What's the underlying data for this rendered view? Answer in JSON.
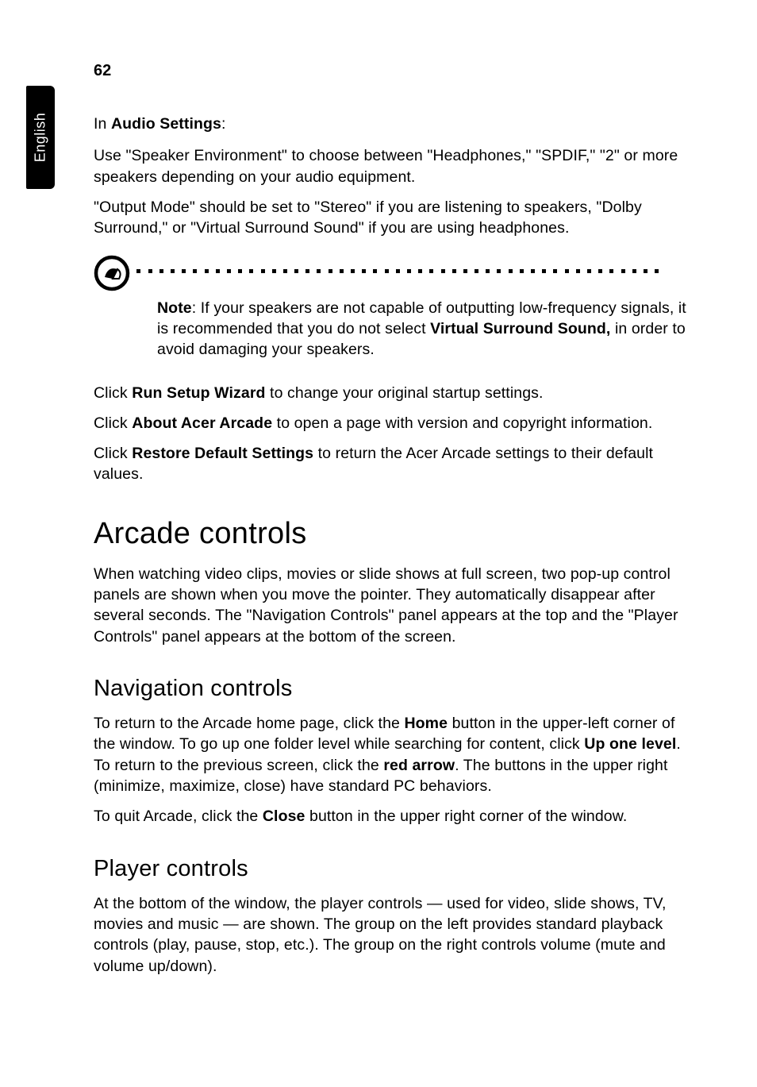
{
  "tab": {
    "label": "English"
  },
  "pageNumber": "62",
  "p1": {
    "pre": "In ",
    "bold": "Audio Settings",
    "post": ":"
  },
  "p2": "Use \"Speaker Environment\" to choose between \"Headphones,\" \"SPDIF,\" \"2\" or more speakers depending on your audio equipment.",
  "p3": "\"Output Mode\" should be set to \"Stereo\" if you are listening to speakers, \"Dolby Surround,\" or \"Virtual Surround Sound\" if you are using headphones.",
  "note": {
    "part1_bold": "Note",
    "part1_rest": ": If your speakers are not capable of outputting low-frequency signals, it is recommended that you do not select ",
    "part2_bold": "Virtual Surround Sound,",
    "part2_rest": " in order to avoid damaging your speakers."
  },
  "p4": {
    "pre": "Click ",
    "bold": "Run Setup Wizard",
    "post": " to change your original startup settings."
  },
  "p5": {
    "pre": "Click ",
    "bold": "About Acer Arcade",
    "post": " to open a page with version and copyright information."
  },
  "p6": {
    "pre": "Click ",
    "bold": "Restore Default Settings",
    "post": " to return the Acer Arcade settings to their default values."
  },
  "h1": "Arcade controls",
  "p7": "When watching video clips, movies or slide shows at full screen, two pop-up control panels are shown when you move the pointer. They automatically disappear after several seconds. The \"Navigation Controls\" panel appears at the top and the \"Player Controls\" panel appears at the bottom of the screen.",
  "h2a": "Navigation controls",
  "p8": {
    "t1": "To return to the Arcade home page, click the ",
    "b1": "Home",
    "t2": " button in the upper-left corner of the window. To go up one folder level while searching for content, click ",
    "b2": "Up one level",
    "t3": ". To return to the previous screen, click the ",
    "b3": "red arrow",
    "t4": ". The buttons in the upper right (minimize, maximize, close) have standard PC behaviors."
  },
  "p9": {
    "t1": "To quit Arcade, click the ",
    "b1": "Close",
    "t2": " button in the upper right corner of the window."
  },
  "h2b": "Player controls",
  "p10": "At the bottom of the window, the player controls — used for video, slide shows, TV, movies and music — are shown. The group on the left provides standard playback controls (play, pause, stop, etc.). The group on the right controls volume (mute and volume up/down)."
}
